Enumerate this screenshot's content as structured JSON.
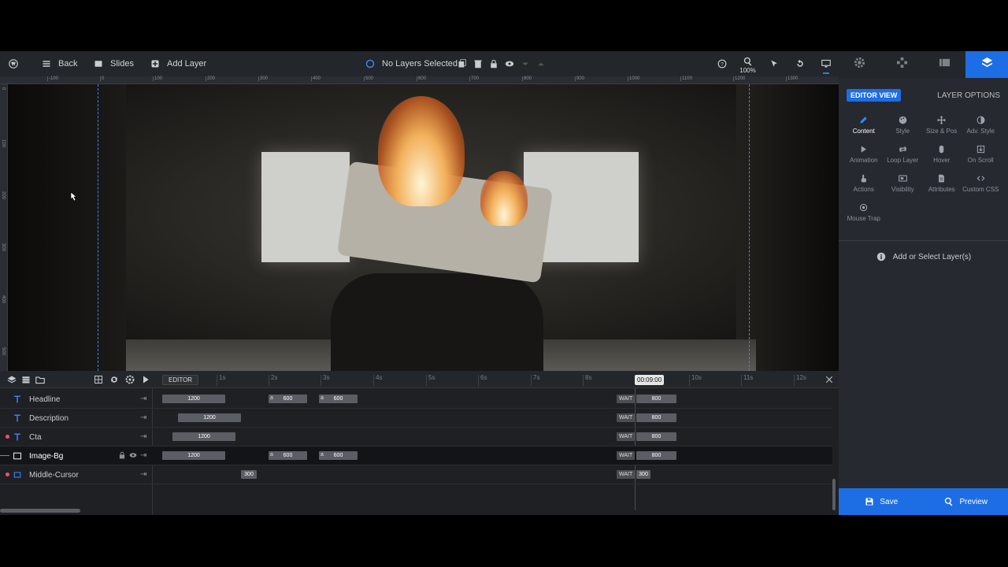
{
  "toolbar": {
    "back": "Back",
    "slides": "Slides",
    "add_layer": "Add Layer",
    "selection_status": "No Layers Selected",
    "zoom": "100%"
  },
  "ruler": {
    "h_ticks": [
      "-100",
      "0",
      "100",
      "200",
      "300",
      "400",
      "500",
      "600",
      "700",
      "800",
      "900",
      "1000",
      "1100",
      "1200",
      "1300"
    ],
    "v_ticks": [
      "0",
      "100",
      "200",
      "300",
      "400",
      "500"
    ]
  },
  "right_panel": {
    "editor_view": "EDITOR VIEW",
    "layer_options": "LAYER OPTIONS",
    "options": [
      {
        "label": "Content",
        "icon": "pencil-icon"
      },
      {
        "label": "Style",
        "icon": "palette-icon"
      },
      {
        "label": "Size & Pos",
        "icon": "move-arrows-icon"
      },
      {
        "label": "Adv. Style",
        "icon": "contrast-icon"
      },
      {
        "label": "Animation",
        "icon": "play-icon"
      },
      {
        "label": "Loop Layer",
        "icon": "loop-icon"
      },
      {
        "label": "Hover",
        "icon": "mouse-icon"
      },
      {
        "label": "On Scroll",
        "icon": "scroll-icon"
      },
      {
        "label": "Actions",
        "icon": "hand-icon"
      },
      {
        "label": "Visibility",
        "icon": "visibility-icon"
      },
      {
        "label": "Attributes",
        "icon": "document-icon"
      },
      {
        "label": "Custom CSS",
        "icon": "code-icon"
      },
      {
        "label": "Mouse Trap",
        "icon": "target-icon"
      }
    ],
    "info": "Add or Select Layer(s)",
    "save": "Save",
    "preview": "Preview"
  },
  "timeline": {
    "editor": "EDITOR",
    "seconds": [
      "1s",
      "2s",
      "3s",
      "4s",
      "5s",
      "6s",
      "7s",
      "8s",
      "10s",
      "11s",
      "12s"
    ],
    "current_time": "00:09:00",
    "rows": [
      {
        "name": "Headline",
        "bars": [
          "1200",
          "600",
          "600"
        ],
        "wait": "WAIT",
        "end": "800"
      },
      {
        "name": "Description",
        "bars": [
          "1200"
        ],
        "wait": "WAIT",
        "end": "800"
      },
      {
        "name": "Cta",
        "bars": [
          "1200"
        ],
        "wait": "WAIT",
        "end": "800"
      },
      {
        "name": "Image-Bg",
        "bars": [
          "1200",
          "600",
          "600"
        ],
        "wait": "WAIT",
        "end": "800"
      },
      {
        "name": "Middle-Cursor",
        "bars": [
          "300"
        ],
        "wait": "WAIT",
        "end": "300"
      }
    ],
    "bar_prefix": "a"
  },
  "colors": {
    "accent": "#1d6ee5",
    "marker": "#ff4d6b"
  }
}
